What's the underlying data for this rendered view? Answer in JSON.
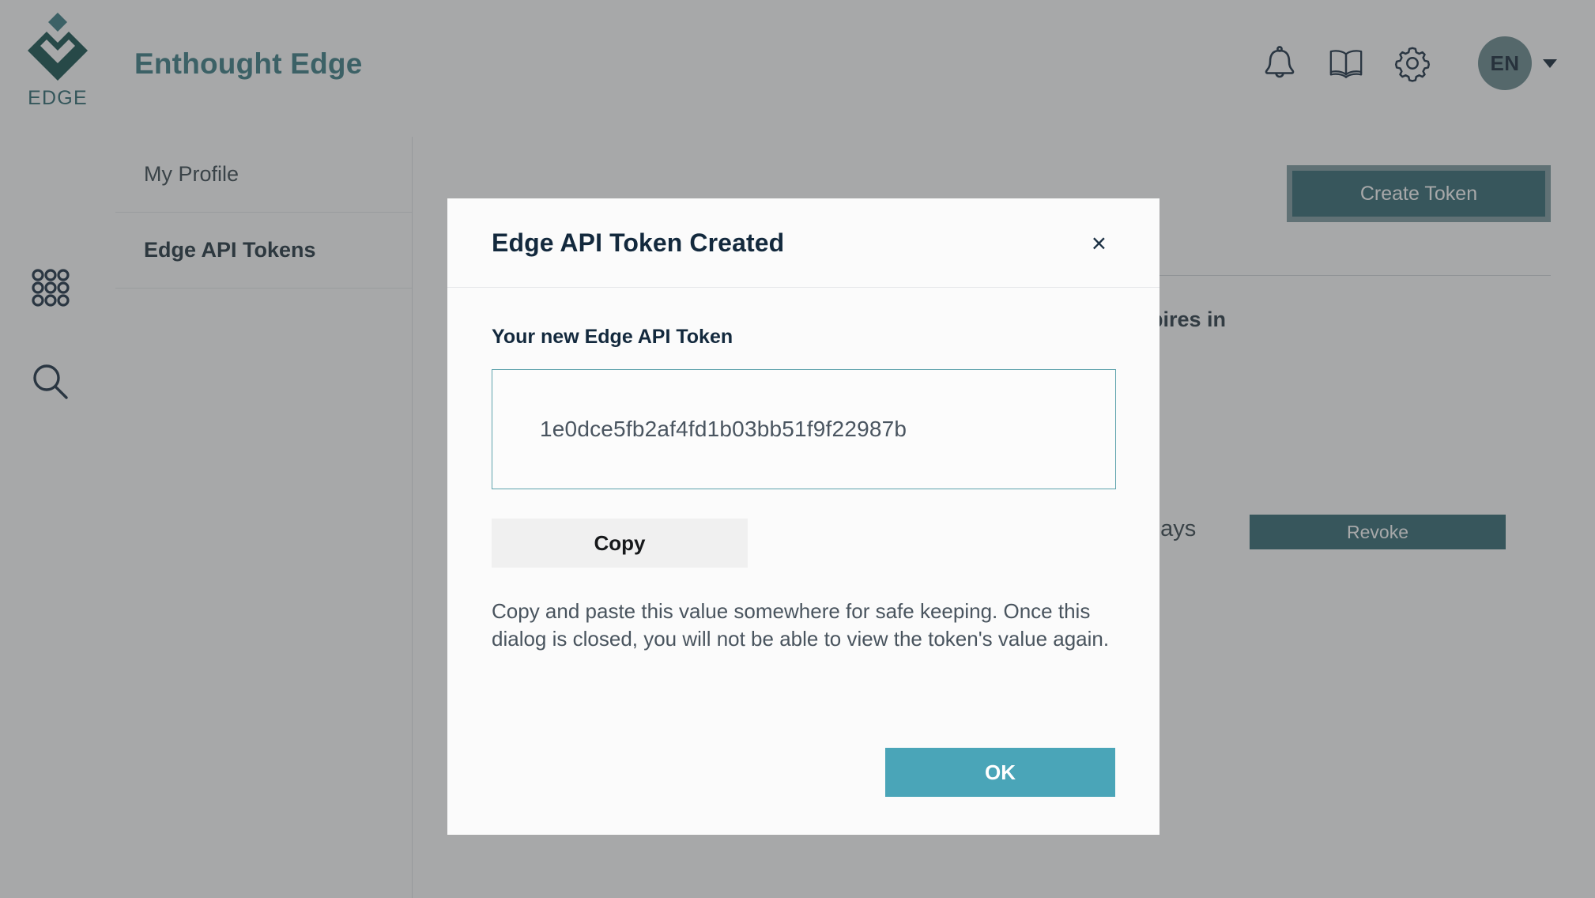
{
  "brand": {
    "logo_word": "EDGE",
    "title": "Enthought Edge",
    "logo_icon": "edge-diamond-logo",
    "accent_teal": "#3d7f86",
    "logo_green": "#16524f"
  },
  "topbar": {
    "icons": [
      {
        "name": "notifications-icon",
        "glyph": "bell"
      },
      {
        "name": "documentation-icon",
        "glyph": "book"
      },
      {
        "name": "settings-icon",
        "glyph": "gear"
      }
    ],
    "avatar_initials": "EN",
    "avatar_color": "#6b8a8f",
    "caret_icon": "chevron-down-icon"
  },
  "rail": {
    "items": [
      {
        "name": "app-launcher-icon",
        "glyph": "grid-dots"
      },
      {
        "name": "search-icon",
        "glyph": "magnifier"
      }
    ]
  },
  "subnav": {
    "items": [
      {
        "label": "My Profile",
        "active": false
      },
      {
        "label": "Edge API Tokens",
        "active": true
      }
    ]
  },
  "main": {
    "create_token_label": "Create Token",
    "create_token_color": "#336a73",
    "column_expires": "Expires in",
    "row_days": "days",
    "revoke_label": "Revoke",
    "revoke_color": "#336a73"
  },
  "dialog": {
    "title": "Edge API Token Created",
    "close_label": "×",
    "field_label": "Your new Edge API Token",
    "token_value": "1e0dce5fb2af4fd1b03bb51f9f22987b",
    "copy_label": "Copy",
    "note": "Copy and paste this value somewhere for safe keeping. Once this dialog is closed, you will not be able to view the token's value again.",
    "ok_label": "OK",
    "ok_color": "#4aa5b8",
    "copy_color": "#f0f0f0",
    "input_border_color": "#5fa3ad"
  }
}
